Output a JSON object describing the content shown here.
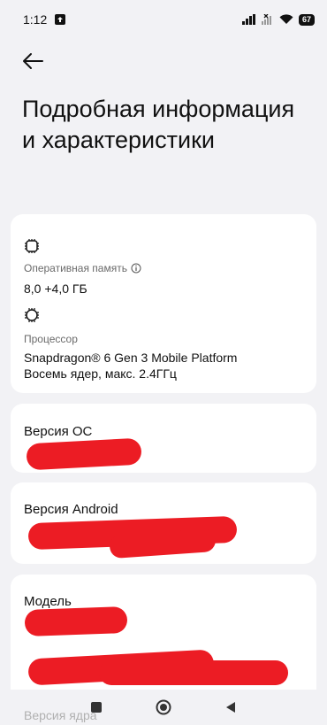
{
  "status_bar": {
    "time": "1:12",
    "battery": "67"
  },
  "header": {
    "title": "Подробная информация и характеристики"
  },
  "specs": {
    "ram_label": "Оперативная память",
    "ram_value": "8,0 +4,0 ГБ",
    "cpu_label": "Процессор",
    "cpu_value_line1": "Snapdragon® 6 Gen 3 Mobile Platform",
    "cpu_value_line2": "Восемь ядер, макс. 2.4ГГц"
  },
  "os_card": {
    "title": "Версия ОС"
  },
  "android_card": {
    "title": "Версия Android"
  },
  "model_card": {
    "title": "Модель"
  },
  "footer": {
    "faded_label": "Версия ядра"
  },
  "icons": {
    "back": "arrow-left-icon",
    "ram": "chip-icon",
    "cpu": "processor-icon",
    "info": "info-icon"
  },
  "colors": {
    "background": "#f2f2f5",
    "card": "#ffffff",
    "redaction": "#ec1c24"
  }
}
